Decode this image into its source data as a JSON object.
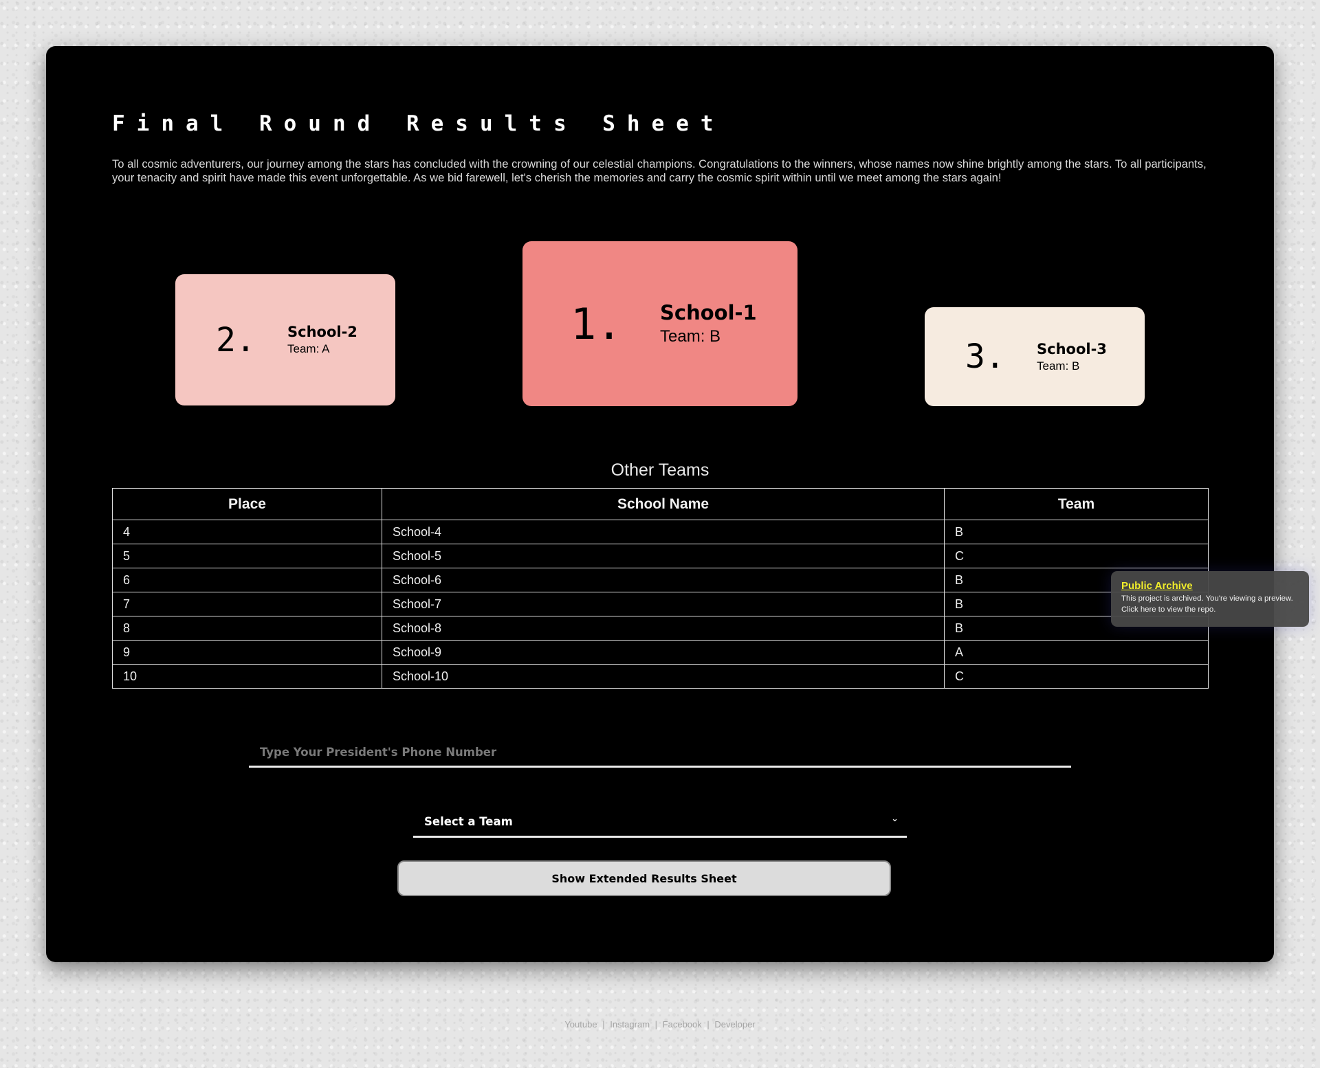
{
  "title": "Final Round Results Sheet",
  "intro": "To all cosmic adventurers, our journey among the stars has concluded with the crowning of our celestial champions. Congratulations to the winners, whose names now shine brightly among the stars. To all participants, your tenacity and spirit have made this event unforgettable. As we bid farewell, let's cherish the memories and carry the cosmic spirit within until we meet among the stars again!",
  "podium": {
    "first": {
      "place": "1.",
      "school": "School-1",
      "team": "Team: B"
    },
    "second": {
      "place": "2.",
      "school": "School-2",
      "team": "Team: A"
    },
    "third": {
      "place": "3.",
      "school": "School-3",
      "team": "Team: B"
    }
  },
  "other_teams": {
    "title": "Other Teams",
    "headers": [
      "Place",
      "School Name",
      "Team"
    ],
    "rows": [
      [
        "4",
        "School-4",
        "B"
      ],
      [
        "5",
        "School-5",
        "C"
      ],
      [
        "6",
        "School-6",
        "B"
      ],
      [
        "7",
        "School-7",
        "B"
      ],
      [
        "8",
        "School-8",
        "B"
      ],
      [
        "9",
        "School-9",
        "A"
      ],
      [
        "10",
        "School-10",
        "C"
      ]
    ]
  },
  "form": {
    "phone_placeholder": "Type Your President's Phone Number",
    "team_select": "Select a Team",
    "submit_label": "Show Extended Results Sheet"
  },
  "archive_notice": {
    "title": "Public Archive",
    "text": "This project is archived. You're viewing a preview. Click here to view the repo."
  },
  "footer": {
    "links": [
      "Youtube",
      "Instagram",
      "Facebook",
      "Developer"
    ],
    "separator": "|"
  },
  "colors": {
    "first_card": "#f08784",
    "second_card": "#f5c6c1",
    "third_card": "#f6ebe0",
    "archive_title": "#f0ec2b"
  },
  "icons": {
    "select_chevron": "chevron-down-icon"
  }
}
